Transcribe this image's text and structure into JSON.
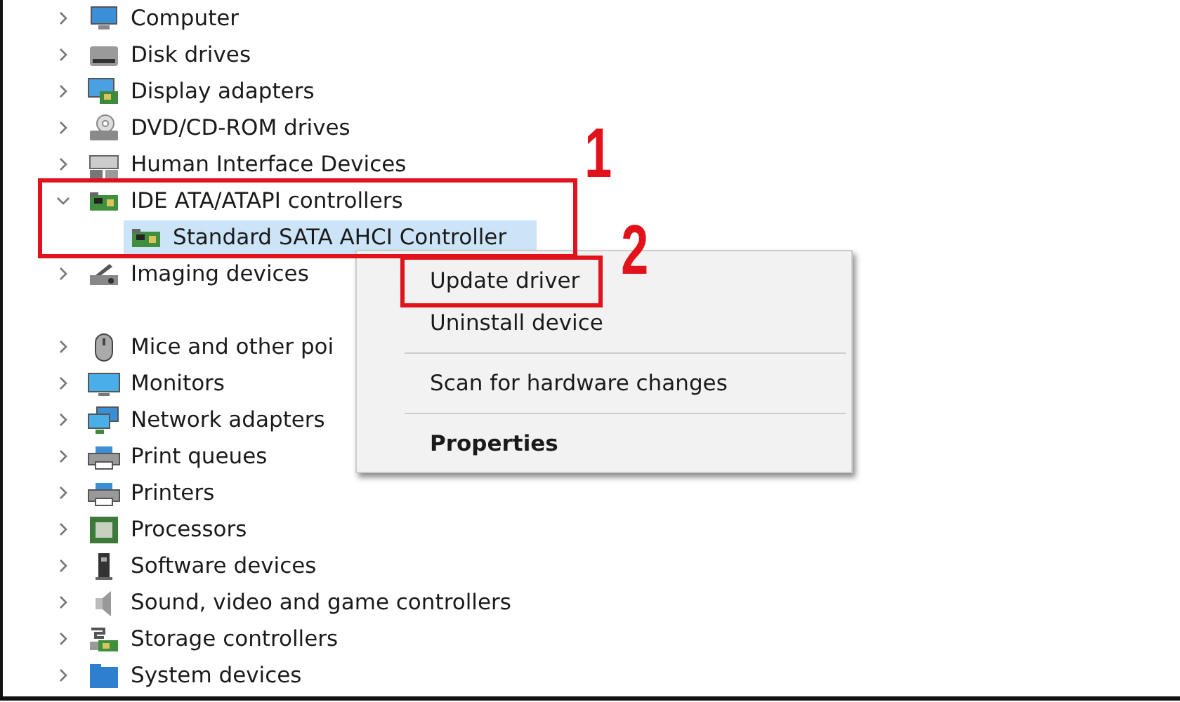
{
  "tree": {
    "items": [
      {
        "label": "Computer",
        "expanded": false,
        "selected": false
      },
      {
        "label": "Disk drives",
        "expanded": false,
        "selected": false
      },
      {
        "label": "Display adapters",
        "expanded": false,
        "selected": false
      },
      {
        "label": "DVD/CD-ROM drives",
        "expanded": false,
        "selected": false
      },
      {
        "label": "Human Interface Devices",
        "expanded": false,
        "selected": false
      },
      {
        "label": "IDE ATA/ATAPI controllers",
        "expanded": true,
        "selected": false,
        "children": [
          {
            "label": "Standard SATA AHCI Controller",
            "selected": true
          }
        ]
      },
      {
        "label": "Imaging devices",
        "expanded": false,
        "selected": false
      },
      {
        "label": "Mice and other poi",
        "expanded": false,
        "selected": false
      },
      {
        "label": "Monitors",
        "expanded": false,
        "selected": false
      },
      {
        "label": "Network adapters",
        "expanded": false,
        "selected": false
      },
      {
        "label": "Print queues",
        "expanded": false,
        "selected": false
      },
      {
        "label": "Printers",
        "expanded": false,
        "selected": false
      },
      {
        "label": "Processors",
        "expanded": false,
        "selected": false
      },
      {
        "label": "Software devices",
        "expanded": false,
        "selected": false
      },
      {
        "label": "Sound, video and game controllers",
        "expanded": false,
        "selected": false
      },
      {
        "label": "Storage controllers",
        "expanded": false,
        "selected": false
      },
      {
        "label": "System devices",
        "expanded": false,
        "selected": false
      }
    ]
  },
  "context_menu": {
    "groups": [
      [
        {
          "label": "Update driver",
          "default": false
        },
        {
          "label": "Uninstall device",
          "default": false
        }
      ],
      [
        {
          "label": "Scan for hardware changes",
          "default": false
        }
      ],
      [
        {
          "label": "Properties",
          "default": true
        }
      ]
    ]
  },
  "annotations": [
    {
      "number": "1"
    },
    {
      "number": "2"
    }
  ]
}
